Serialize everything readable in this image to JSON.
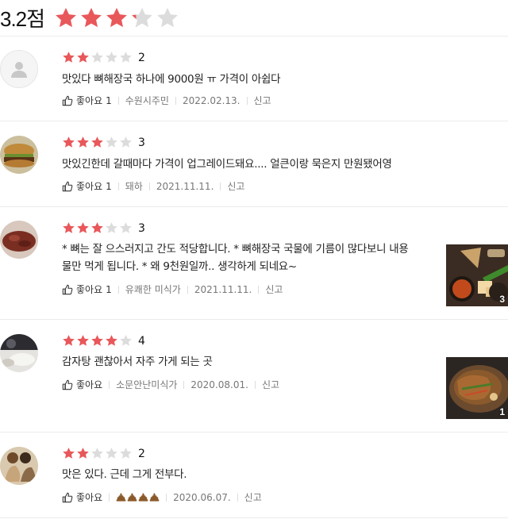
{
  "summary": {
    "score": "3.2점",
    "rating": 3.2,
    "star_color": "#e8585a",
    "star_empty_color": "#dcdcdc"
  },
  "reviews": [
    {
      "rating": 2,
      "rating_label": "2",
      "lines": [
        "맛있다 뼈해장국 하나에 9000원 ㅠ 가격이 아쉽다"
      ],
      "like_label": "좋아요",
      "like_count": "1",
      "author": "수원시주민",
      "date": "2022.02.13.",
      "report": "신고"
    },
    {
      "rating": 3,
      "rating_label": "3",
      "lines": [
        "맛있긴한데 갈때마다 가격이 업그레이드돼요.... 얼큰이랑 묵은지 만원됐어영"
      ],
      "like_label": "좋아요",
      "like_count": "1",
      "author": "돼하",
      "date": "2021.11.11.",
      "report": "신고"
    },
    {
      "rating": 3,
      "rating_label": "3",
      "lines": [
        "* 뼈는 잘 으스러지고 간도 적당합니다. * 뼈해장국 국물에 기름이 많다보니 내용",
        "물만 먹게 됩니다. * 왜 9천원일까.. 생각하게 되네요~"
      ],
      "like_label": "좋아요",
      "like_count": "1",
      "author": "유쾌한 미식가",
      "date": "2021.11.11.",
      "report": "신고",
      "photo_count": "3"
    },
    {
      "rating": 4,
      "rating_label": "4",
      "lines": [
        "감자탕 괜찮아서 자주 가게 되는 곳"
      ],
      "like_label": "좋아요",
      "like_count": "",
      "author": "소문안난미식가",
      "date": "2020.08.01.",
      "report": "신고",
      "photo_count": "1"
    },
    {
      "rating": 2,
      "rating_label": "2",
      "lines": [
        "맛은 있다. 근데 그게 전부다."
      ],
      "like_label": "좋아요",
      "like_count": "",
      "author": "",
      "date": "2020.06.07.",
      "report": "신고"
    }
  ]
}
